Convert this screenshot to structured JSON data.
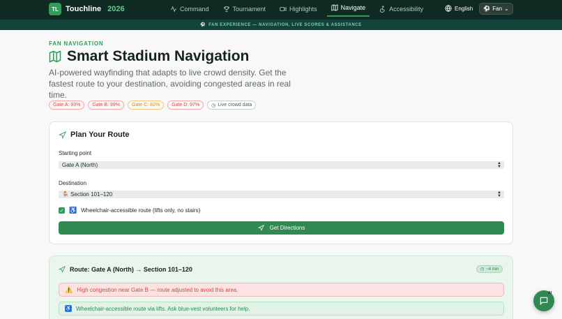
{
  "header": {
    "logo_text": "TL",
    "brand_name": "Touchline",
    "brand_year": "2026",
    "nav": [
      {
        "label": "Command",
        "icon": "activity-icon"
      },
      {
        "label": "Tournament",
        "icon": "trophy-icon"
      },
      {
        "label": "Highlights",
        "icon": "video-icon"
      },
      {
        "label": "Navigate",
        "icon": "map-icon",
        "active": true
      },
      {
        "label": "Accessibility",
        "icon": "accessibility-icon"
      }
    ],
    "language": "English",
    "role": "Fan"
  },
  "banner": {
    "text": "FAN EXPERIENCE — NAVIGATION, LIVE SCORES & ASSISTANCE"
  },
  "page": {
    "eyebrow": "FAN NAVIGATION",
    "title": "Smart Stadium Navigation",
    "subtitle": "AI-powered wayfinding that adapts to live crowd density. Get the fastest route to your destination, avoiding congested areas in real time."
  },
  "gates": [
    {
      "label": "Gate A: 93%",
      "status": "red"
    },
    {
      "label": "Gate B: 99%",
      "status": "red"
    },
    {
      "label": "Gate C: 82%",
      "status": "amber"
    },
    {
      "label": "Gate D: 97%",
      "status": "red"
    }
  ],
  "live_chip": "Live crowd data",
  "plan": {
    "title": "Plan Your Route",
    "start_label": "Starting point",
    "start_value": "Gate A (North)",
    "dest_label": "Destination",
    "dest_value": "🪑 Section 101–120",
    "wheelchair_label": "Wheelchair-accessible route (lifts only, no stairs)",
    "wheelchair_checked": true,
    "button_label": "Get Directions"
  },
  "route": {
    "title": "Route: Gate A (North) → Section 101–120",
    "eta": "~4 min",
    "warning": "High congestion near Gate B — route adjusted to avoid this area.",
    "info": "Wheelchair-accessible route via lifts. Ask blue-vest volunteers for help."
  },
  "chat": {
    "badge": "AI"
  },
  "colors": {
    "brand_green": "#2f9e5a",
    "header_bg": "#0f2a22",
    "danger": "#d24545",
    "warning": "#d98a16"
  }
}
